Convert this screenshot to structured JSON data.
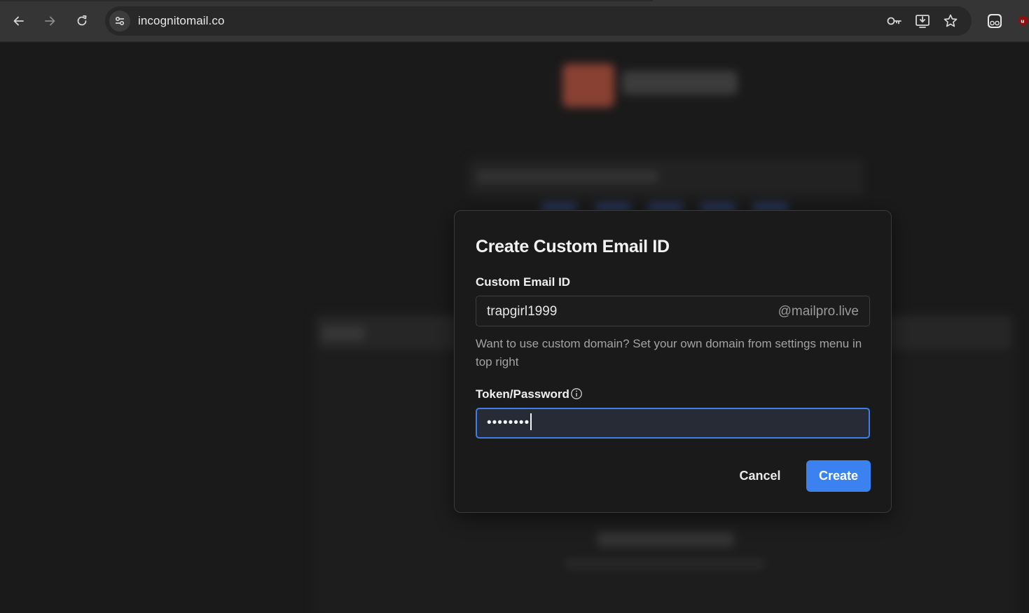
{
  "browser": {
    "url": "incognitomail.co",
    "icons": {
      "back": "arrow-left-icon",
      "forward": "arrow-right-icon",
      "reload": "reload-icon",
      "site_info": "tune-icon",
      "password_key": "key-icon",
      "install_app": "install-icon",
      "bookmark": "star-icon",
      "incognito_ext": "glasses-icon",
      "extension": "ublock-icon"
    }
  },
  "modal": {
    "title": "Create Custom Email ID",
    "email_label": "Custom Email ID",
    "email_value": "trapgirl1999",
    "email_domain": "@mailpro.live",
    "hint": "Want to use custom domain? Set your own domain from settings menu in top right",
    "password_label": "Token/Password",
    "password_masked": "••••••••",
    "cancel_label": "Cancel",
    "create_label": "Create"
  },
  "colors": {
    "accent": "#3b82f0",
    "modal_bg": "#1a1a1a",
    "page_bg": "#1e1e1e",
    "brand_logo": "#9b4a3a"
  }
}
